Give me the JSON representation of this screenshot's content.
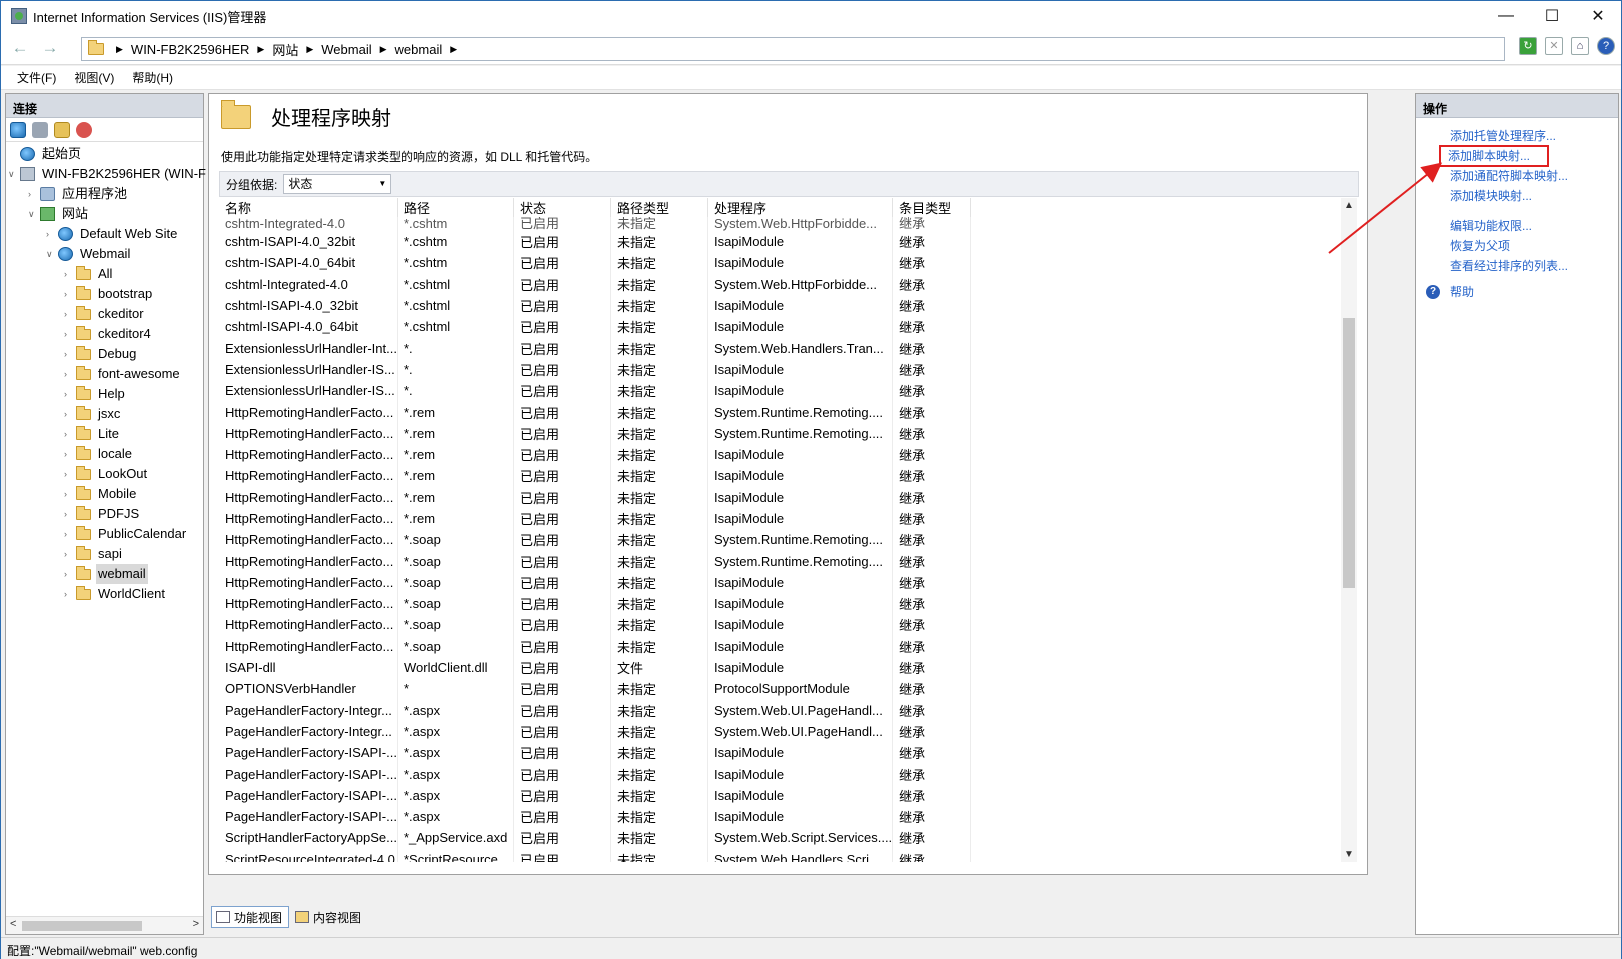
{
  "window": {
    "title": "Internet Information Services (IIS)管理器",
    "minimize": "—",
    "maximize": "☐",
    "close": "✕"
  },
  "address": {
    "breadcrumbs": [
      "WIN-FB2K2596HER",
      "网站",
      "Webmail",
      "webmail"
    ]
  },
  "menu": [
    "文件(F)",
    "视图(V)",
    "帮助(H)"
  ],
  "connections": {
    "header": "连接",
    "tree": [
      {
        "label": "起始页",
        "level": 0,
        "icon": "start-page-icon"
      },
      {
        "label": "WIN-FB2K2596HER (WIN-F",
        "level": 0,
        "icon": "server-icon",
        "expanded": true
      },
      {
        "label": "应用程序池",
        "level": 1,
        "icon": "app-pool-icon"
      },
      {
        "label": "网站",
        "level": 1,
        "icon": "sites-icon",
        "expanded": true
      },
      {
        "label": "Default Web Site",
        "level": 2,
        "icon": "globe-icon"
      },
      {
        "label": "Webmail",
        "level": 2,
        "icon": "globe-icon",
        "expanded": true
      },
      {
        "label": "All",
        "level": 3,
        "icon": "folder-icon"
      },
      {
        "label": "bootstrap",
        "level": 3,
        "icon": "folder-icon"
      },
      {
        "label": "ckeditor",
        "level": 3,
        "icon": "folder-icon"
      },
      {
        "label": "ckeditor4",
        "level": 3,
        "icon": "folder-icon"
      },
      {
        "label": "Debug",
        "level": 3,
        "icon": "folder-icon"
      },
      {
        "label": "font-awesome",
        "level": 3,
        "icon": "folder-icon"
      },
      {
        "label": "Help",
        "level": 3,
        "icon": "folder-icon"
      },
      {
        "label": "jsxc",
        "level": 3,
        "icon": "folder-icon"
      },
      {
        "label": "Lite",
        "level": 3,
        "icon": "folder-icon"
      },
      {
        "label": "locale",
        "level": 3,
        "icon": "folder-icon"
      },
      {
        "label": "LookOut",
        "level": 3,
        "icon": "folder-icon"
      },
      {
        "label": "Mobile",
        "level": 3,
        "icon": "folder-icon"
      },
      {
        "label": "PDFJS",
        "level": 3,
        "icon": "folder-icon"
      },
      {
        "label": "PublicCalendar",
        "level": 3,
        "icon": "folder-icon"
      },
      {
        "label": "sapi",
        "level": 3,
        "icon": "folder-icon"
      },
      {
        "label": "webmail",
        "level": 3,
        "icon": "folder-icon",
        "selected": true
      },
      {
        "label": "WorldClient",
        "level": 3,
        "icon": "folder-icon"
      }
    ]
  },
  "feature": {
    "title": "处理程序映射",
    "description": "使用此功能指定处理特定请求类型的响应的资源，如 DLL 和托管代码。",
    "group_label": "分组依据:",
    "group_value": "状态",
    "columns": [
      "名称",
      "路径",
      "状态",
      "路径类型",
      "处理程序",
      "条目类型"
    ],
    "first_row": [
      "cshtm-Integrated-4.0",
      "*.cshtm",
      "已启用",
      "未指定",
      "System.Web.HttpForbidde...",
      "继承"
    ],
    "rows": [
      [
        "cshtm-ISAPI-4.0_32bit",
        "*.cshtm",
        "已启用",
        "未指定",
        "IsapiModule",
        "继承"
      ],
      [
        "cshtm-ISAPI-4.0_64bit",
        "*.cshtm",
        "已启用",
        "未指定",
        "IsapiModule",
        "继承"
      ],
      [
        "cshtml-Integrated-4.0",
        "*.cshtml",
        "已启用",
        "未指定",
        "System.Web.HttpForbidde...",
        "继承"
      ],
      [
        "cshtml-ISAPI-4.0_32bit",
        "*.cshtml",
        "已启用",
        "未指定",
        "IsapiModule",
        "继承"
      ],
      [
        "cshtml-ISAPI-4.0_64bit",
        "*.cshtml",
        "已启用",
        "未指定",
        "IsapiModule",
        "继承"
      ],
      [
        "ExtensionlessUrlHandler-Int...",
        "*.",
        "已启用",
        "未指定",
        "System.Web.Handlers.Tran...",
        "继承"
      ],
      [
        "ExtensionlessUrlHandler-IS...",
        "*.",
        "已启用",
        "未指定",
        "IsapiModule",
        "继承"
      ],
      [
        "ExtensionlessUrlHandler-IS...",
        "*.",
        "已启用",
        "未指定",
        "IsapiModule",
        "继承"
      ],
      [
        "HttpRemotingHandlerFacto...",
        "*.rem",
        "已启用",
        "未指定",
        "System.Runtime.Remoting....",
        "继承"
      ],
      [
        "HttpRemotingHandlerFacto...",
        "*.rem",
        "已启用",
        "未指定",
        "System.Runtime.Remoting....",
        "继承"
      ],
      [
        "HttpRemotingHandlerFacto...",
        "*.rem",
        "已启用",
        "未指定",
        "IsapiModule",
        "继承"
      ],
      [
        "HttpRemotingHandlerFacto...",
        "*.rem",
        "已启用",
        "未指定",
        "IsapiModule",
        "继承"
      ],
      [
        "HttpRemotingHandlerFacto...",
        "*.rem",
        "已启用",
        "未指定",
        "IsapiModule",
        "继承"
      ],
      [
        "HttpRemotingHandlerFacto...",
        "*.rem",
        "已启用",
        "未指定",
        "IsapiModule",
        "继承"
      ],
      [
        "HttpRemotingHandlerFacto...",
        "*.soap",
        "已启用",
        "未指定",
        "System.Runtime.Remoting....",
        "继承"
      ],
      [
        "HttpRemotingHandlerFacto...",
        "*.soap",
        "已启用",
        "未指定",
        "System.Runtime.Remoting....",
        "继承"
      ],
      [
        "HttpRemotingHandlerFacto...",
        "*.soap",
        "已启用",
        "未指定",
        "IsapiModule",
        "继承"
      ],
      [
        "HttpRemotingHandlerFacto...",
        "*.soap",
        "已启用",
        "未指定",
        "IsapiModule",
        "继承"
      ],
      [
        "HttpRemotingHandlerFacto...",
        "*.soap",
        "已启用",
        "未指定",
        "IsapiModule",
        "继承"
      ],
      [
        "HttpRemotingHandlerFacto...",
        "*.soap",
        "已启用",
        "未指定",
        "IsapiModule",
        "继承"
      ],
      [
        "ISAPI-dll",
        "WorldClient.dll",
        "已启用",
        "文件",
        "IsapiModule",
        "继承"
      ],
      [
        "OPTIONSVerbHandler",
        "*",
        "已启用",
        "未指定",
        "ProtocolSupportModule",
        "继承"
      ],
      [
        "PageHandlerFactory-Integr...",
        "*.aspx",
        "已启用",
        "未指定",
        "System.Web.UI.PageHandl...",
        "继承"
      ],
      [
        "PageHandlerFactory-Integr...",
        "*.aspx",
        "已启用",
        "未指定",
        "System.Web.UI.PageHandl...",
        "继承"
      ],
      [
        "PageHandlerFactory-ISAPI-...",
        "*.aspx",
        "已启用",
        "未指定",
        "IsapiModule",
        "继承"
      ],
      [
        "PageHandlerFactory-ISAPI-...",
        "*.aspx",
        "已启用",
        "未指定",
        "IsapiModule",
        "继承"
      ],
      [
        "PageHandlerFactory-ISAPI-...",
        "*.aspx",
        "已启用",
        "未指定",
        "IsapiModule",
        "继承"
      ],
      [
        "PageHandlerFactory-ISAPI-...",
        "*.aspx",
        "已启用",
        "未指定",
        "IsapiModule",
        "继承"
      ],
      [
        "ScriptHandlerFactoryAppSe...",
        "*_AppService.axd",
        "已启用",
        "未指定",
        "System.Web.Script.Services....",
        "继承"
      ],
      [
        "ScriptResourceIntegrated-4.0",
        "*ScriptResource....",
        "已启用",
        "未指定",
        "System.Web.Handlers.Scri...",
        "继承"
      ]
    ],
    "tabs": [
      "功能视图",
      "内容视图"
    ]
  },
  "actions": {
    "header": "操作",
    "group1": [
      "添加托管处理程序...",
      "添加脚本映射...",
      "添加通配符脚本映射...",
      "添加模块映射..."
    ],
    "group2": [
      "编辑功能权限...",
      "恢复为父项",
      "查看经过排序的列表..."
    ],
    "help": "帮助",
    "highlighted_index": 1,
    "highlight_color": "#e02020"
  },
  "status": "配置:\"Webmail/webmail\" web.config",
  "colors": {
    "link": "#2563c9",
    "panel_header": "#d6dbe3"
  }
}
